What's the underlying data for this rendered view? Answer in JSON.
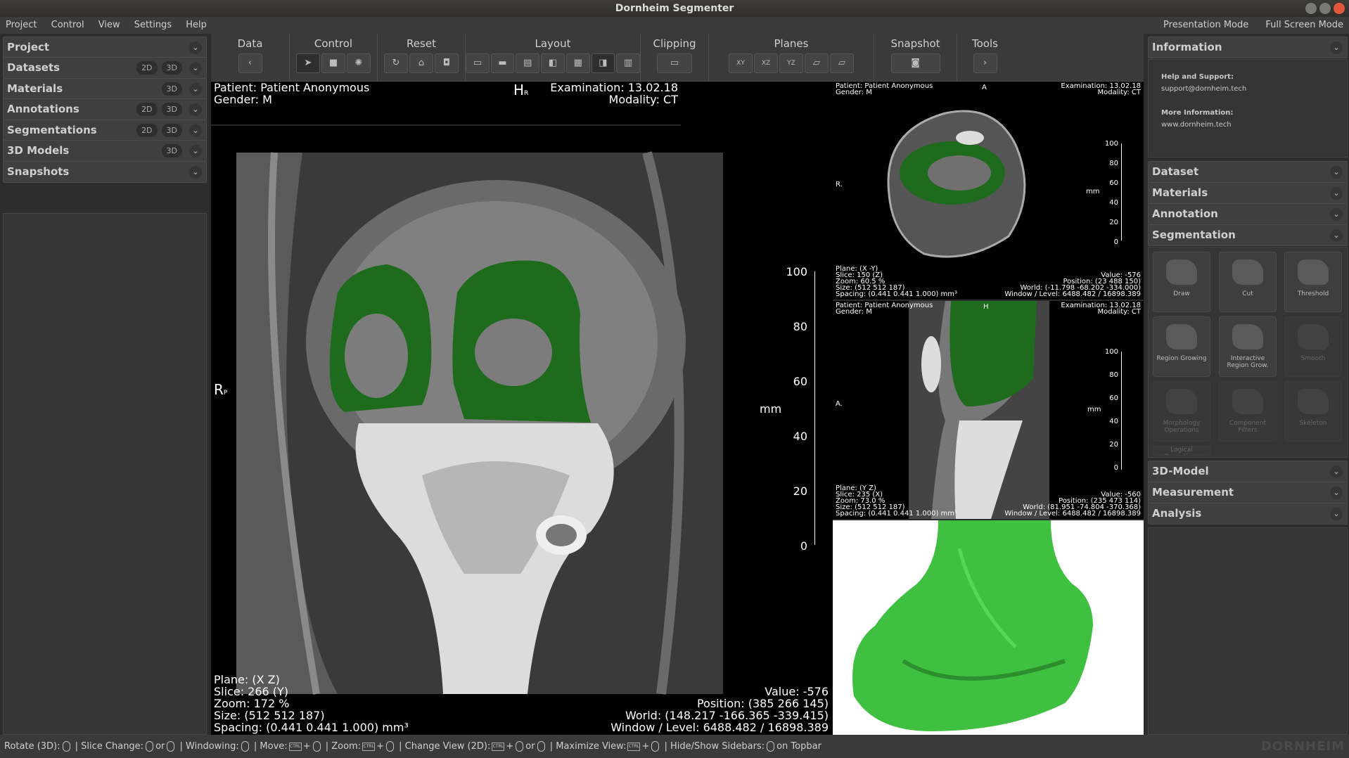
{
  "window": {
    "title": "Dornheim Segmenter"
  },
  "menu": {
    "items": [
      "Project",
      "Control",
      "View",
      "Settings",
      "Help"
    ],
    "right": [
      "Presentation Mode",
      "Full Screen Mode"
    ]
  },
  "left_sidebar": [
    {
      "label": "Project",
      "tags": []
    },
    {
      "label": "Datasets",
      "tags": [
        "2D",
        "3D"
      ]
    },
    {
      "label": "Materials",
      "tags": [
        "3D"
      ]
    },
    {
      "label": "Annotations",
      "tags": [
        "2D",
        "3D"
      ]
    },
    {
      "label": "Segmentations",
      "tags": [
        "2D",
        "3D"
      ]
    },
    {
      "label": "3D Models",
      "tags": [
        "3D"
      ]
    },
    {
      "label": "Snapshots",
      "tags": []
    }
  ],
  "toolbar": {
    "groups": [
      "Data",
      "Control",
      "Reset",
      "Layout",
      "Clipping",
      "Planes",
      "Snapshot",
      "Tools"
    ],
    "plane_buttons": [
      "XY",
      "XZ",
      "YZ"
    ]
  },
  "main_view": {
    "patient": "Patient: Patient Anonymous",
    "gender": "Gender: M",
    "examination": "Examination: 13.02.18",
    "modality": "Modality: CT",
    "orient_top": "H",
    "orient_top_sub": "R",
    "orient_left": "R",
    "orient_left_sub": "P",
    "plane": "Plane: (X Z)",
    "slice": "Slice: 266 (Y)",
    "zoom": "Zoom: 172 %",
    "size": "Size: (512 512 187)",
    "spacing": "Spacing: (0.441 0.441 1.000) mm³",
    "value": "Value: -576",
    "position": "Position: (385 266 145)",
    "world": "World: (148.217 -166.365 -339.415)",
    "window_level": "Window / Level: 6488.482 / 16898.389",
    "scale_ticks": [
      "100",
      "80",
      "60",
      "40",
      "20",
      "0"
    ],
    "scale_unit": "mm"
  },
  "top_view": {
    "patient": "Patient: Patient Anonymous",
    "gender": "Gender: M",
    "examination": "Examination: 13.02.18",
    "modality": "Modality: CT",
    "orient_top": "A",
    "orient_left": "R.",
    "plane": "Plane: (X -Y)",
    "slice": "Slice: 150 (Z)",
    "zoom": "Zoom: 60.5 %",
    "size": "Size: (512 512 187)",
    "spacing": "Spacing: (0.441 0.441 1.000) mm³",
    "value": "Value: -576",
    "position": "Position: (23 488 150)",
    "world": "World: (-11.798 -68.202 -334.000)",
    "window_level": "Window / Level: 6488.482 / 16898.389",
    "scale_ticks": [
      "100",
      "80",
      "60",
      "40",
      "20",
      "0"
    ],
    "scale_unit": "mm"
  },
  "mid_view": {
    "patient": "Patient: Patient Anonymous",
    "gender": "Gender: M",
    "examination": "Examination: 13.02.18",
    "modality": "Modality: CT",
    "orient_top": "H",
    "orient_left": "A.",
    "plane": "Plane: (Y Z)",
    "slice": "Slice: 235 (X)",
    "zoom": "Zoom: 73.0 %",
    "size": "Size: (512 512 187)",
    "spacing": "Spacing: (0.441 0.441 1.000) mm³",
    "value": "Value: -560",
    "position": "Position: (235 473 114)",
    "world": "World: (81.951 -74.804 -370.368)",
    "window_level": "Window / Level: 6488.482 / 16898.389",
    "scale_ticks": [
      "100",
      "80",
      "60",
      "40",
      "20",
      "0"
    ],
    "scale_unit": "mm"
  },
  "right_sidebar": {
    "information": "Information",
    "help_label": "Help and Support:",
    "help_email": "support@dornheim.tech",
    "more_label": "More Information:",
    "more_url": "www.dornheim.tech",
    "sections": [
      "Dataset",
      "Materials",
      "Annotation",
      "Segmentation"
    ],
    "tools": [
      "Draw",
      "Cut",
      "Threshold",
      "Region Growing",
      "Interactive Region Grow.",
      "Smooth",
      "Morphology Operations",
      "Component Filters",
      "Skeleton",
      "Logical Operations"
    ],
    "lower_sections": [
      "3D-Model",
      "Measurement",
      "Analysis"
    ]
  },
  "status": {
    "rotate": "Rotate (3D):",
    "slice": "| Slice Change:",
    "or": "or",
    "windowing": "| Windowing:",
    "move": "| Move:",
    "zoom": "| Zoom:",
    "change_view": "| Change View (2D):",
    "maximize": "| Maximize View:",
    "hide": "| Hide/Show Sidebars:",
    "hide_suffix": "on Topbar",
    "logo": "DORNHEIM"
  },
  "colors": {
    "segment": "#1f6b1e",
    "model": "#3fc040",
    "bg": "#2d2d2d"
  }
}
